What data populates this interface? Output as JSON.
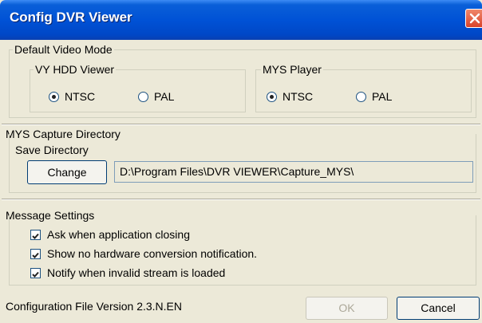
{
  "window": {
    "title": "Config DVR Viewer"
  },
  "video_mode": {
    "label": "Default Video Mode",
    "vy_hdd": {
      "label": "VY HDD Viewer",
      "ntsc": "NTSC",
      "pal": "PAL",
      "selected": "NTSC"
    },
    "mys_player": {
      "label": "MYS Player",
      "ntsc": "NTSC",
      "pal": "PAL",
      "selected": "NTSC"
    }
  },
  "capture": {
    "label": "MYS Capture Directory",
    "save_label": "Save Directory",
    "change_label": "Change",
    "path": "D:\\Program Files\\DVR VIEWER\\Capture_MYS\\"
  },
  "messages": {
    "label": "Message Settings",
    "items": [
      {
        "label": "Ask when application closing",
        "checked": true
      },
      {
        "label": "Show no hardware conversion notification.",
        "checked": true
      },
      {
        "label": "Notify when invalid stream is loaded",
        "checked": true
      }
    ]
  },
  "footer": {
    "version": "Configuration File Version 2.3.N.EN",
    "ok_label": "OK",
    "cancel_label": "Cancel"
  }
}
